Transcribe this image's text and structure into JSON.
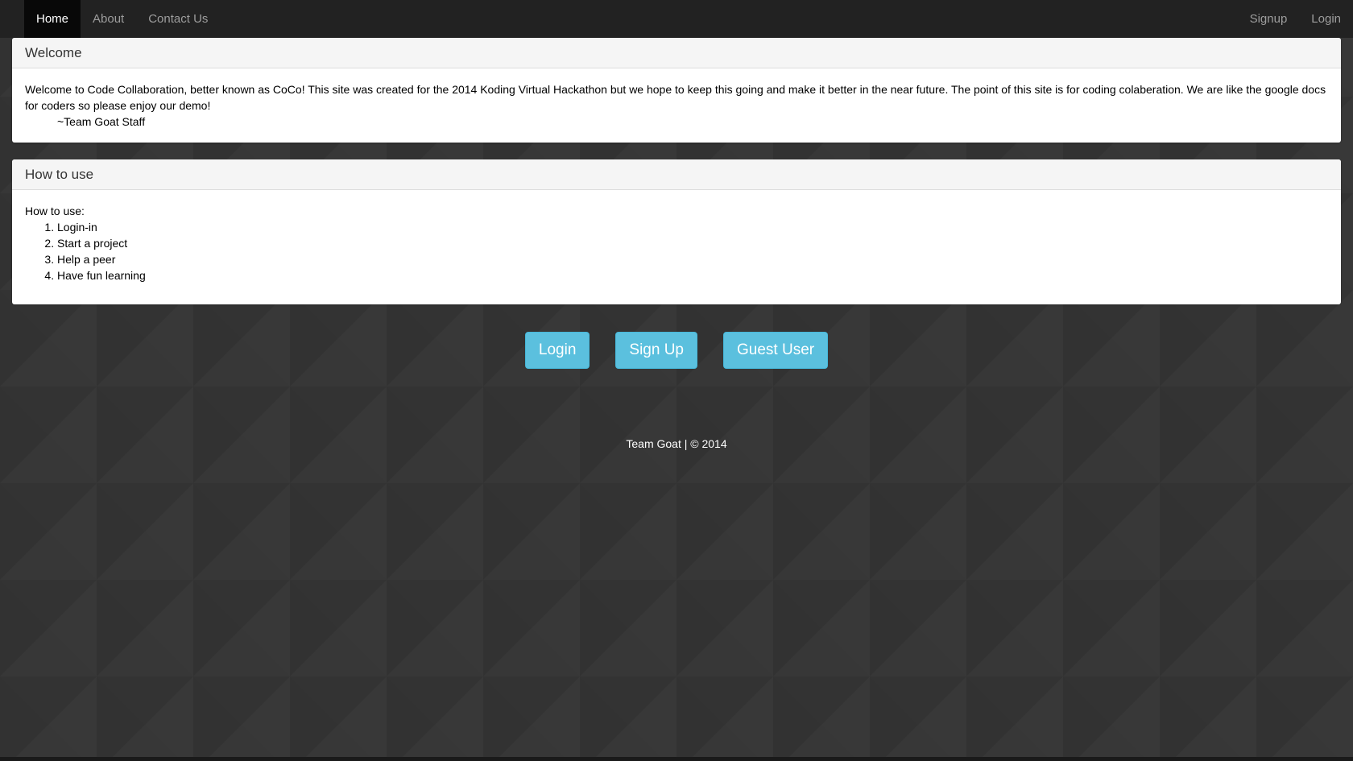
{
  "nav": {
    "left": [
      {
        "label": "Home",
        "active": true
      },
      {
        "label": "About",
        "active": false
      },
      {
        "label": "Contact Us",
        "active": false
      }
    ],
    "right": [
      {
        "label": "Signup"
      },
      {
        "label": "Login"
      }
    ]
  },
  "welcome": {
    "heading": "Welcome",
    "body": "Welcome to Code Collaboration, better known as CoCo! This site was created for the 2014 Koding Virtual Hackathon but we hope to keep this going and make it better in the near future. The point of this site is for coding colaberation. We are like the google docs for coders so please enjoy our demo!",
    "signature": "~Team Goat Staff"
  },
  "howto": {
    "heading": "How to use",
    "intro": "How to use:",
    "steps": [
      "Login-in",
      "Start a project",
      "Help a peer",
      "Have fun learning"
    ]
  },
  "buttons": {
    "login": "Login",
    "signup": "Sign Up",
    "guest": "Guest User"
  },
  "footer": {
    "text": "Team Goat | © 2014"
  },
  "colors": {
    "navbar": "#222222",
    "background": "#353535",
    "button": "#5bc0de",
    "panel_heading": "#f5f5f5"
  }
}
